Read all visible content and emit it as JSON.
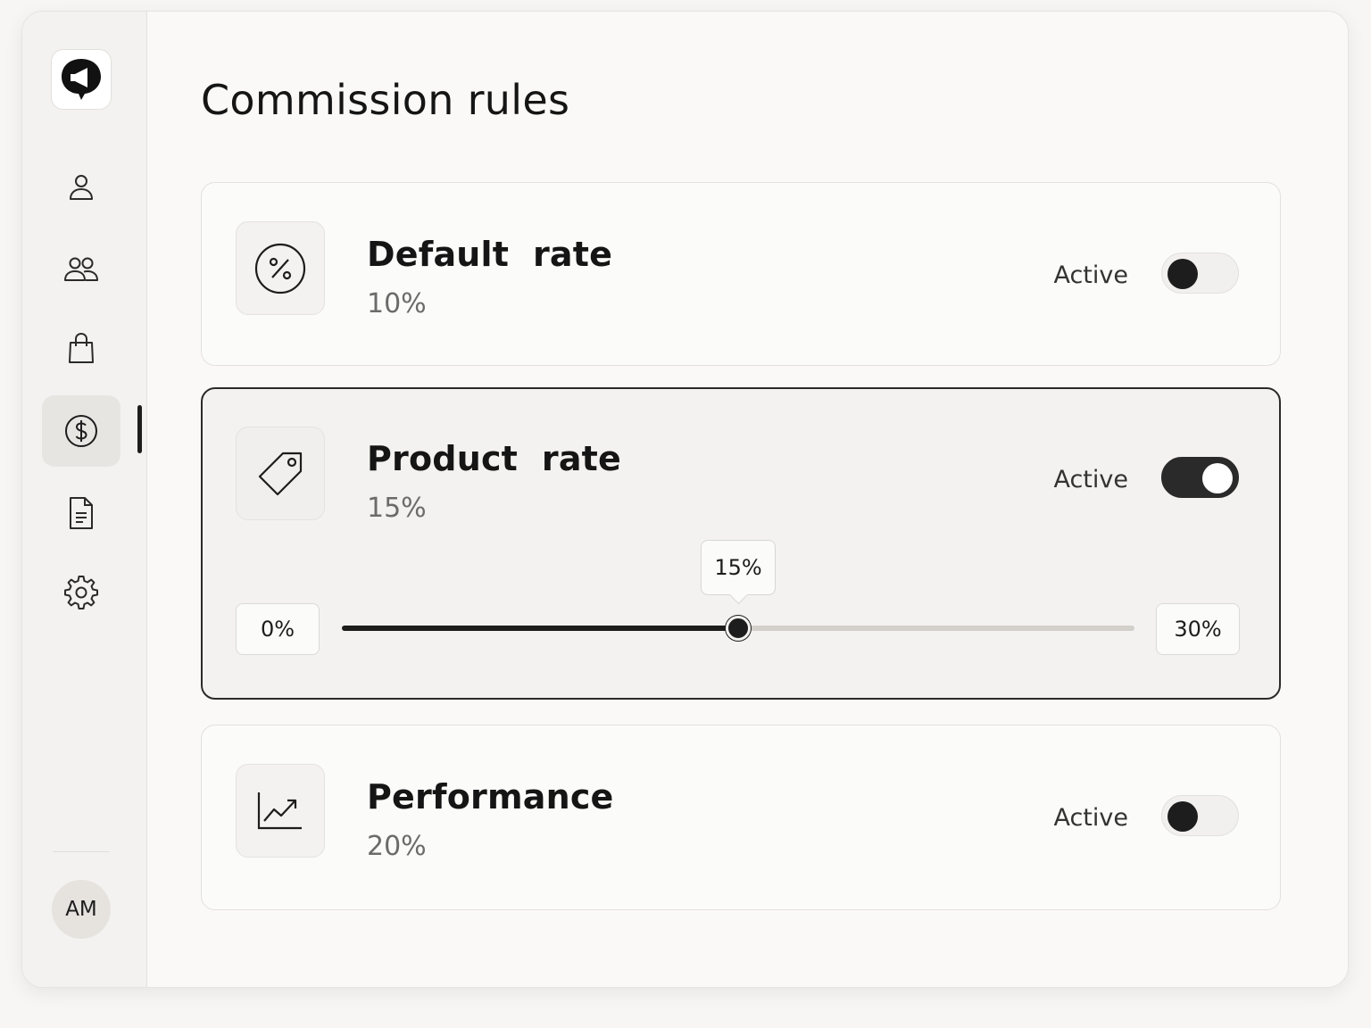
{
  "sidebar": {
    "logo_icon": "megaphone-icon",
    "items": [
      {
        "icon": "user-icon",
        "name": "sidebar-item-profile"
      },
      {
        "icon": "users-icon",
        "name": "sidebar-item-team"
      },
      {
        "icon": "shopping-bag-icon",
        "name": "sidebar-item-products"
      },
      {
        "icon": "dollar-circle-icon",
        "name": "sidebar-item-commissions",
        "active": true
      },
      {
        "icon": "document-icon",
        "name": "sidebar-item-reports"
      },
      {
        "icon": "gear-icon",
        "name": "sidebar-item-settings"
      }
    ],
    "avatar_initials": "AM"
  },
  "page": {
    "title": "Commission rules"
  },
  "rules": [
    {
      "title": "Default  rate",
      "value": "10%",
      "status_label": "Active",
      "icon": "percent-circle-icon",
      "toggle_on": false
    },
    {
      "title": "Product  rate",
      "value": "15%",
      "status_label": "Active",
      "icon": "tag-icon",
      "toggle_on": true,
      "selected": true,
      "slider": {
        "min_label": "0%",
        "max_label": "30%",
        "min": 0,
        "max": 30,
        "value": 15,
        "value_label": "15%"
      }
    },
    {
      "title": "Performance",
      "value": "20%",
      "status_label": "Active",
      "icon": "trend-chart-icon",
      "toggle_on": false
    }
  ],
  "colors": {
    "accent": "#1d1d1d",
    "background": "#faf9f8",
    "sidebar": "#f3f2f0",
    "muted_text": "#6b6b6b"
  }
}
